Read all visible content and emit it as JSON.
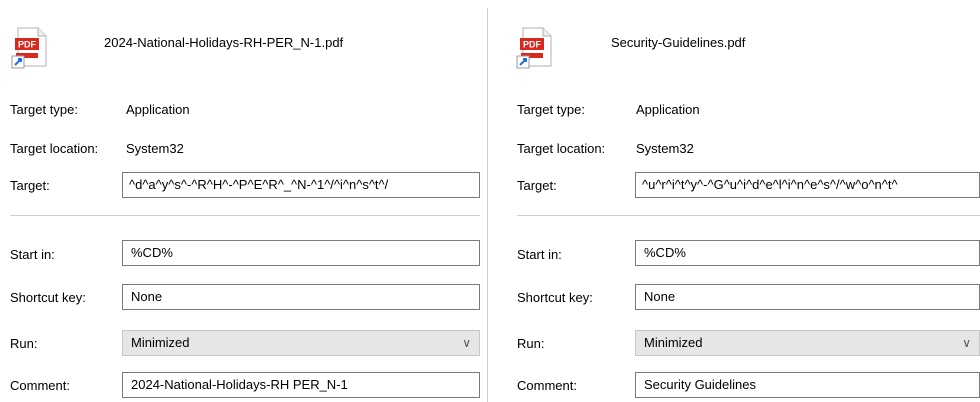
{
  "left": {
    "file_name": "2024-National-Holidays-RH-PER_N-1.pdf",
    "icon": {
      "name": "pdf-shortcut-icon",
      "badge_text": "PDF",
      "accent": "#d9281d"
    },
    "target_type": {
      "label": "Target type:",
      "value": "Application"
    },
    "target_location": {
      "label": "Target location:",
      "value": "System32"
    },
    "target": {
      "label": "Target:",
      "value": "^d^a^y^s^-^R^H^-^P^E^R^_^N-^1^/^i^n^s^t^/"
    },
    "start_in": {
      "label": "Start in:",
      "value": "%CD%"
    },
    "shortcut_key": {
      "label": "Shortcut key:",
      "value": "None"
    },
    "run": {
      "label": "Run:",
      "value": "Minimized"
    },
    "comment": {
      "label": "Comment:",
      "value": "2024-National-Holidays-RH PER_N-1"
    }
  },
  "right": {
    "file_name": "Security-Guidelines.pdf",
    "icon": {
      "name": "pdf-shortcut-icon",
      "badge_text": "PDF",
      "accent": "#d9281d"
    },
    "target_type": {
      "label": "Target type:",
      "value": "Application"
    },
    "target_location": {
      "label": "Target location:",
      "value": "System32"
    },
    "target": {
      "label": "Target:",
      "value": "^u^r^i^t^y^-^G^u^i^d^e^l^i^n^e^s^/^w^o^n^t^"
    },
    "start_in": {
      "label": "Start in:",
      "value": "%CD%"
    },
    "shortcut_key": {
      "label": "Shortcut key:",
      "value": "None"
    },
    "run": {
      "label": "Run:",
      "value": "Minimized"
    },
    "comment": {
      "label": "Comment:",
      "value": "Security Guidelines"
    }
  }
}
